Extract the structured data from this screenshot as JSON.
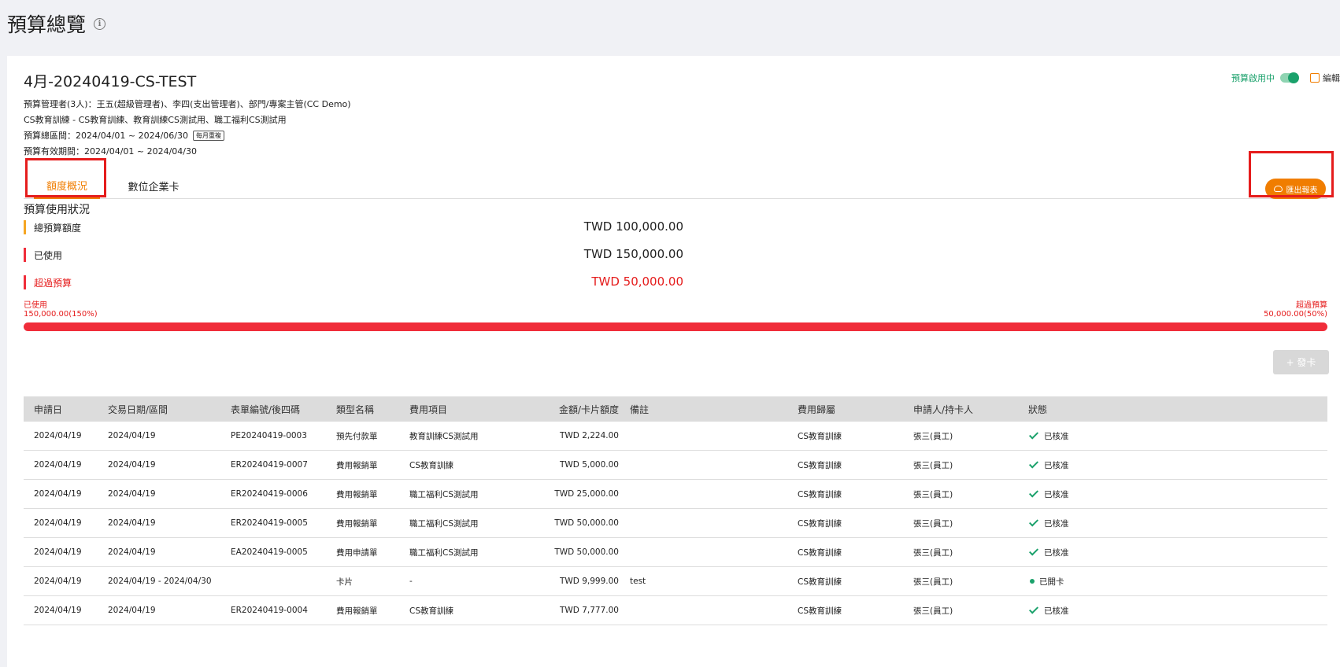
{
  "page": {
    "title": "預算總覽"
  },
  "budget": {
    "name": "4月-20240419-CS-TEST",
    "enabled_label": "預算啟用中",
    "edit_label": "編輯",
    "managers": "預算管理者(3人)：王五(超級管理者)、李四(支出管理者)、部門/專案主管(CC Demo)",
    "categories": "CS教育訓練 - CS教育訓練、教育訓練CS測試用、職工福利CS測試用",
    "period": "預算總區間：2024/04/01 ~ 2024/06/30",
    "period_tag": "每月重複",
    "valid_period": "預算有效期間：2024/04/01 ~ 2024/04/30"
  },
  "tabs": [
    {
      "label": "額度概況"
    },
    {
      "label": "數位企業卡"
    }
  ],
  "export_label": "匯出報表",
  "usage": {
    "section_title": "預算使用狀況",
    "stats": [
      {
        "label": "總預算額度",
        "value": "TWD 100,000.00"
      },
      {
        "label": "已使用",
        "value": "TWD 150,000.00"
      },
      {
        "label": "超過預算",
        "value": "TWD 50,000.00"
      }
    ],
    "progress": {
      "used_label": "已使用",
      "used_value": "150,000.00(150%)",
      "over_label": "超過預算",
      "over_value": "50,000.00(50%)",
      "percent": 150
    }
  },
  "issue_card_label": "+ 發卡",
  "table": {
    "headers": [
      "申請日",
      "交易日期/區間",
      "表單編號/後四碼",
      "類型名稱",
      "費用項目",
      "金額/卡片額度",
      "備註",
      "費用歸屬",
      "申請人/持卡人",
      "狀態"
    ],
    "rows": [
      [
        "2024/04/19",
        "2024/04/19",
        "PE20240419-0003",
        "預先付款單",
        "教育訓練CS測試用",
        "TWD 2,224.00",
        "",
        "CS教育訓練",
        "張三(員工)",
        "已核准"
      ],
      [
        "2024/04/19",
        "2024/04/19",
        "ER20240419-0007",
        "費用報銷單",
        "CS教育訓練",
        "TWD 5,000.00",
        "",
        "CS教育訓練",
        "張三(員工)",
        "已核准"
      ],
      [
        "2024/04/19",
        "2024/04/19",
        "ER20240419-0006",
        "費用報銷單",
        "職工福利CS測試用",
        "TWD 25,000.00",
        "",
        "CS教育訓練",
        "張三(員工)",
        "已核准"
      ],
      [
        "2024/04/19",
        "2024/04/19",
        "ER20240419-0005",
        "費用報銷單",
        "職工福利CS測試用",
        "TWD 50,000.00",
        "",
        "CS教育訓練",
        "張三(員工)",
        "已核准"
      ],
      [
        "2024/04/19",
        "2024/04/19",
        "EA20240419-0005",
        "費用申請單",
        "職工福利CS測試用",
        "TWD 50,000.00",
        "",
        "CS教育訓練",
        "張三(員工)",
        "已核准"
      ],
      [
        "2024/04/19",
        "2024/04/19 - 2024/04/30",
        "",
        "卡片",
        "-",
        "TWD 9,999.00",
        "test",
        "CS教育訓練",
        "張三(員工)",
        "已開卡"
      ],
      [
        "2024/04/19",
        "2024/04/19",
        "ER20240419-0004",
        "費用報銷單",
        "CS教育訓練",
        "TWD 7,777.00",
        "",
        "CS教育訓練",
        "張三(員工)",
        "已核准"
      ]
    ]
  },
  "colors": {
    "accent": "#f07d00",
    "danger": "#f02d3a",
    "success": "#1aa16b",
    "highlight": "#e51c1c"
  }
}
